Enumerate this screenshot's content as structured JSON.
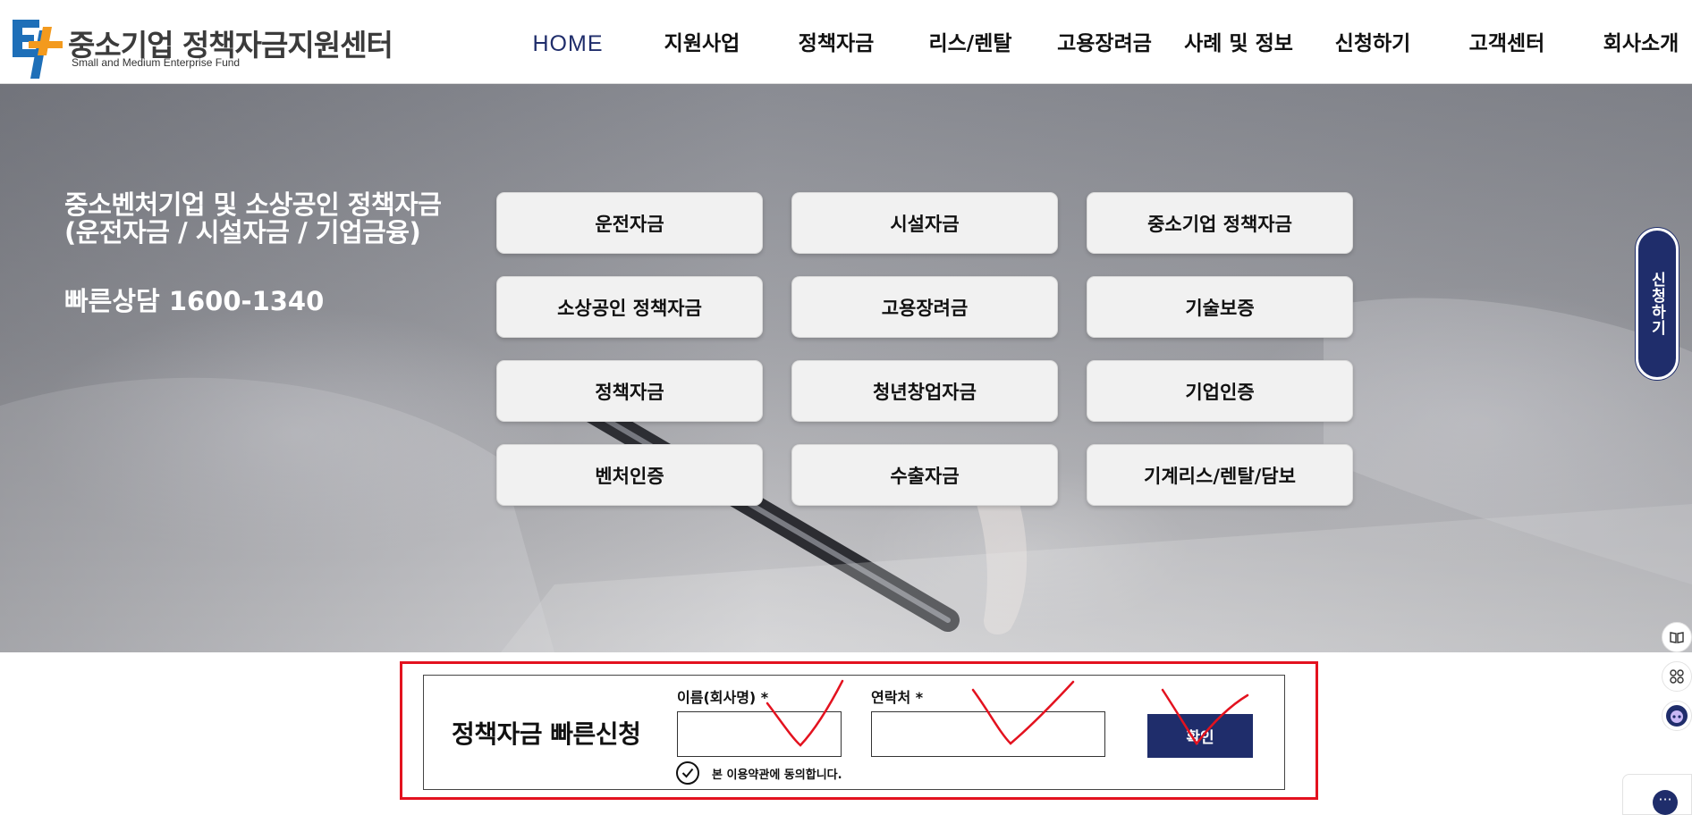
{
  "header": {
    "logo_title": "중소기업 정책자금지원센터",
    "logo_subtitle": "Small and Medium Enterprise Fund",
    "nav": [
      "HOME",
      "지원사업",
      "정책자금",
      "리스/렌탈",
      "고용장려금",
      "사례 및 정보",
      "신청하기",
      "고객센터",
      "회사소개"
    ],
    "active_nav": "HOME"
  },
  "hero": {
    "title_line1": "중소벤처기업 및 소상공인 정책자금",
    "title_line2": "(운전자금 / 시설자금 / 기업금융)",
    "phone": "빠른상담 1600-1340",
    "tiles": [
      "운전자금",
      "시설자금",
      "중소기업 정책자금",
      "소상공인 정책자금",
      "고용장려금",
      "기술보증",
      "정책자금",
      "청년창업자금",
      "기업인증",
      "벤처인증",
      "수출자금",
      "기계리스/렌탈/담보"
    ]
  },
  "side_tab": {
    "label": "신청하기"
  },
  "form": {
    "title": "정책자금 빠른신청",
    "name_label": "이름(회사명) *",
    "name_value": "",
    "phone_label": "연락처 *",
    "phone_value": "",
    "confirm_label": "확인",
    "agree_label": "본 이용약관에 동의합니다.",
    "agree_checked": true
  },
  "icons": [
    "logo-icon",
    "book-icon",
    "grid-icon",
    "robot-icon",
    "chat-icon",
    "check-icon"
  ],
  "colors": {
    "brand_navy": "#1f2d6b",
    "highlight_red": "#e3121f",
    "logo_blue": "#1e6fb8",
    "logo_orange": "#f39a1e"
  }
}
